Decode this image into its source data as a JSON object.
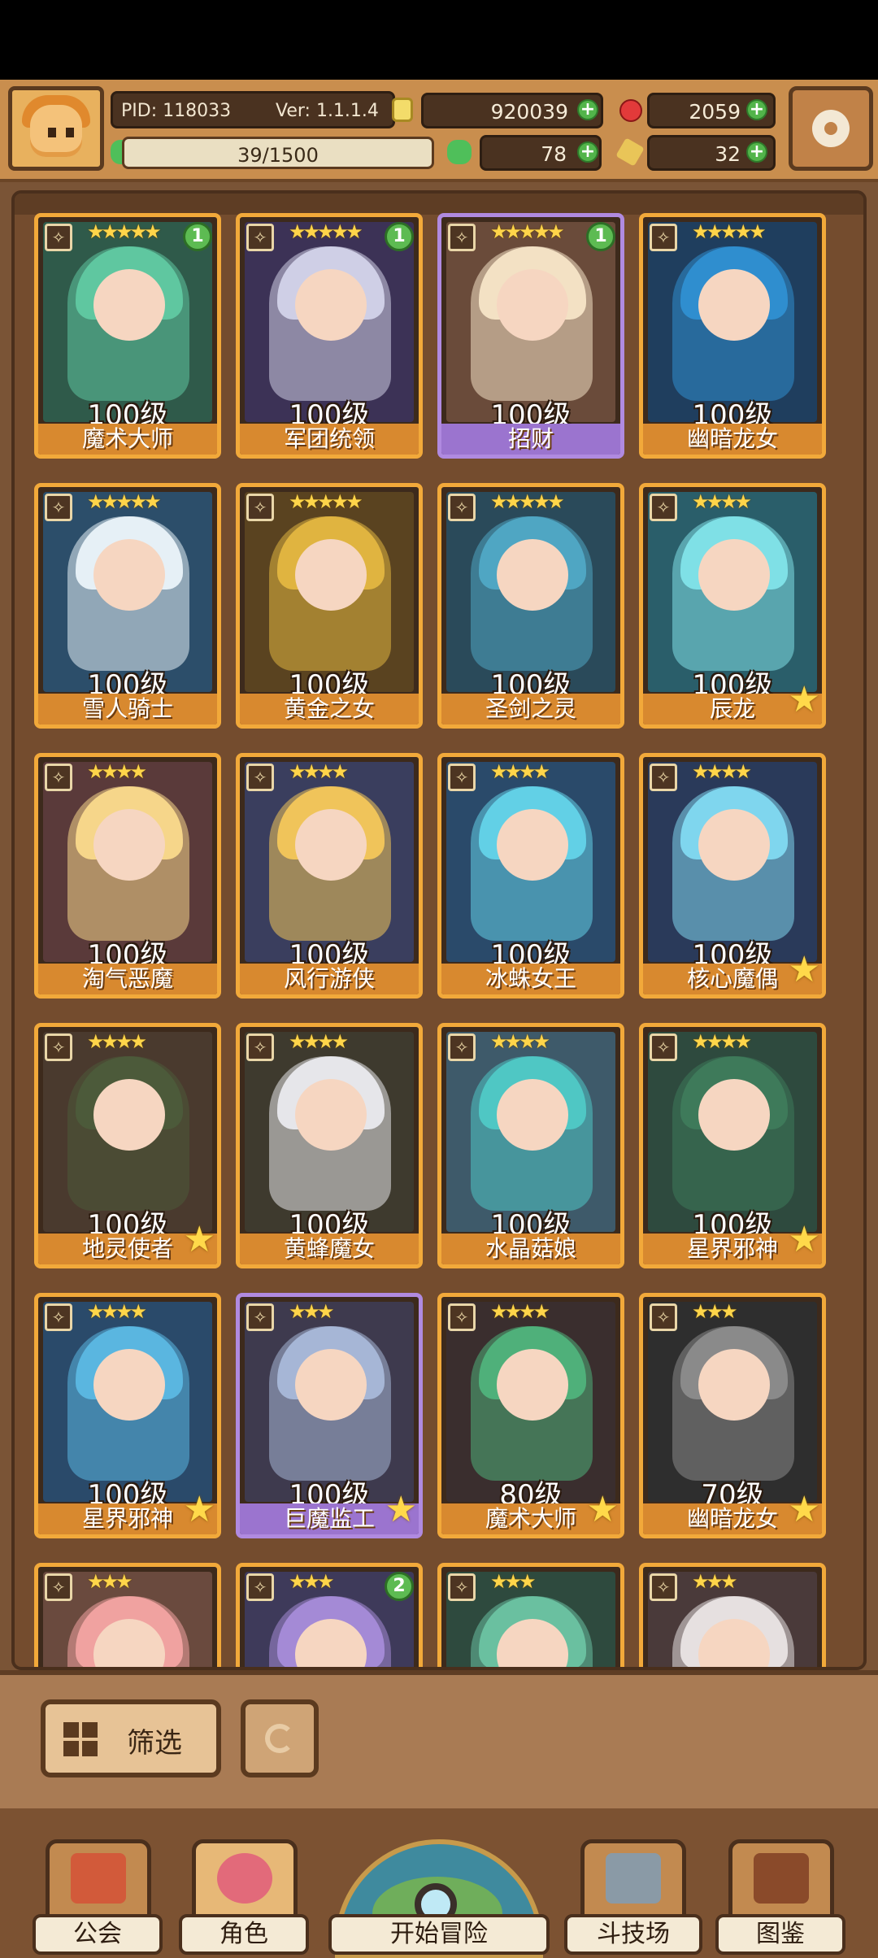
{
  "player": {
    "pid_label": "PID: 118033",
    "version_label": "Ver: 1.1.1.4",
    "xp": "39/1500",
    "gold": "920039",
    "gems": "2059",
    "clover": "78",
    "keys": "32"
  },
  "colors": {
    "card_gold": "#f2a93a",
    "card_purple": "#b08ae0",
    "plus_green": "#52b44a"
  },
  "heroes": [
    {
      "name": "魔术大师",
      "level": "100级",
      "stars": "★★★★★",
      "badge": "1",
      "art": "#2f5a4a",
      "hair": "#5fc7a0",
      "frame": "gold",
      "upgrade": false
    },
    {
      "name": "军团统领",
      "level": "100级",
      "stars": "★★★★★",
      "badge": "1",
      "art": "#3c3256",
      "hair": "#cfcfe6",
      "frame": "gold",
      "upgrade": false
    },
    {
      "name": "招财",
      "level": "100级",
      "stars": "★★★★★",
      "badge": "1",
      "art": "#6a4b3a",
      "hair": "#f3e1c4",
      "frame": "purple",
      "upgrade": false
    },
    {
      "name": "幽暗龙女",
      "level": "100级",
      "stars": "★★★★★",
      "badge": "",
      "art": "#1f3e5e",
      "hair": "#2f8ecf",
      "frame": "gold",
      "upgrade": false
    },
    {
      "name": "雪人骑士",
      "level": "100级",
      "stars": "★★★★★",
      "badge": "",
      "art": "#2c4e6a",
      "hair": "#e6f0f6",
      "frame": "gold",
      "upgrade": false
    },
    {
      "name": "黄金之女",
      "level": "100级",
      "stars": "★★★★★",
      "badge": "",
      "art": "#5a4320",
      "hair": "#e0b440",
      "frame": "gold",
      "upgrade": false
    },
    {
      "name": "圣剑之灵",
      "level": "100级",
      "stars": "★★★★★",
      "badge": "",
      "art": "#2a4a5a",
      "hair": "#4fa6c3",
      "frame": "gold",
      "upgrade": false
    },
    {
      "name": "辰龙",
      "level": "100级",
      "stars": "★★★★",
      "badge": "",
      "art": "#2a5e6a",
      "hair": "#7fe0e6",
      "frame": "gold",
      "upgrade": true
    },
    {
      "name": "淘气恶魔",
      "level": "100级",
      "stars": "★★★★",
      "badge": "",
      "art": "#5a3a3a",
      "hair": "#f6d68a",
      "frame": "gold",
      "upgrade": false
    },
    {
      "name": "风行游侠",
      "level": "100级",
      "stars": "★★★★",
      "badge": "",
      "art": "#3a3e5e",
      "hair": "#f0c45a",
      "frame": "gold",
      "upgrade": false
    },
    {
      "name": "冰蛛女王",
      "level": "100级",
      "stars": "★★★★",
      "badge": "",
      "art": "#2a4a6a",
      "hair": "#62d0e6",
      "frame": "gold",
      "upgrade": false
    },
    {
      "name": "核心魔偶",
      "level": "100级",
      "stars": "★★★★",
      "badge": "",
      "art": "#2a3a5a",
      "hair": "#7fd6ee",
      "frame": "gold",
      "upgrade": true
    },
    {
      "name": "地灵使者",
      "level": "100级",
      "stars": "★★★★",
      "badge": "",
      "art": "#4a3a2e",
      "hair": "#4c5a3a",
      "frame": "gold",
      "upgrade": true
    },
    {
      "name": "黄蜂魔女",
      "level": "100级",
      "stars": "★★★★",
      "badge": "",
      "art": "#3e3a2e",
      "hair": "#e6e6ea",
      "frame": "gold",
      "upgrade": false
    },
    {
      "name": "水晶菇娘",
      "level": "100级",
      "stars": "★★★★",
      "badge": "",
      "art": "#3e5a6a",
      "hair": "#4fc7c4",
      "frame": "gold",
      "upgrade": false
    },
    {
      "name": "星界邪神",
      "level": "100级",
      "stars": "★★★★",
      "badge": "",
      "art": "#2e4a3e",
      "hair": "#3e7a5a",
      "frame": "gold",
      "upgrade": true
    },
    {
      "name": "星界邪神",
      "level": "100级",
      "stars": "★★★★",
      "badge": "",
      "art": "#2a4a6a",
      "hair": "#5ab6e0",
      "frame": "gold",
      "upgrade": true
    },
    {
      "name": "巨魔监工",
      "level": "100级",
      "stars": "★★★",
      "badge": "",
      "art": "#3e3a4e",
      "hair": "#a6b6d6",
      "frame": "purple",
      "upgrade": true
    },
    {
      "name": "魔术大师",
      "level": "80级",
      "stars": "★★★★",
      "badge": "",
      "art": "#3a2e2e",
      "hair": "#4fb07a",
      "frame": "gold",
      "upgrade": true
    },
    {
      "name": "幽暗龙女",
      "level": "70级",
      "stars": "★★★",
      "badge": "",
      "art": "#2e2e2e",
      "hair": "#8a8a8a",
      "frame": "gold",
      "upgrade": true
    },
    {
      "name": "",
      "level": "",
      "stars": "★★★",
      "badge": "",
      "art": "#6a4a3e",
      "hair": "#f0a2a0",
      "frame": "gold",
      "upgrade": false
    },
    {
      "name": "",
      "level": "",
      "stars": "★★★",
      "badge": "2",
      "art": "#3e3a5a",
      "hair": "#a48ad6",
      "frame": "gold",
      "upgrade": false
    },
    {
      "name": "",
      "level": "",
      "stars": "★★★",
      "badge": "",
      "art": "#2e4a3e",
      "hair": "#6ac0a0",
      "frame": "gold",
      "upgrade": false
    },
    {
      "name": "",
      "level": "",
      "stars": "★★★",
      "badge": "",
      "art": "#4a3a3a",
      "hair": "#e6e0e0",
      "frame": "gold",
      "upgrade": false
    }
  ],
  "filter": {
    "label": "筛选"
  },
  "nav": {
    "guild": "公会",
    "hero": "角色",
    "adventure": "开始冒险",
    "arena": "斗技场",
    "codex": "图鉴"
  }
}
